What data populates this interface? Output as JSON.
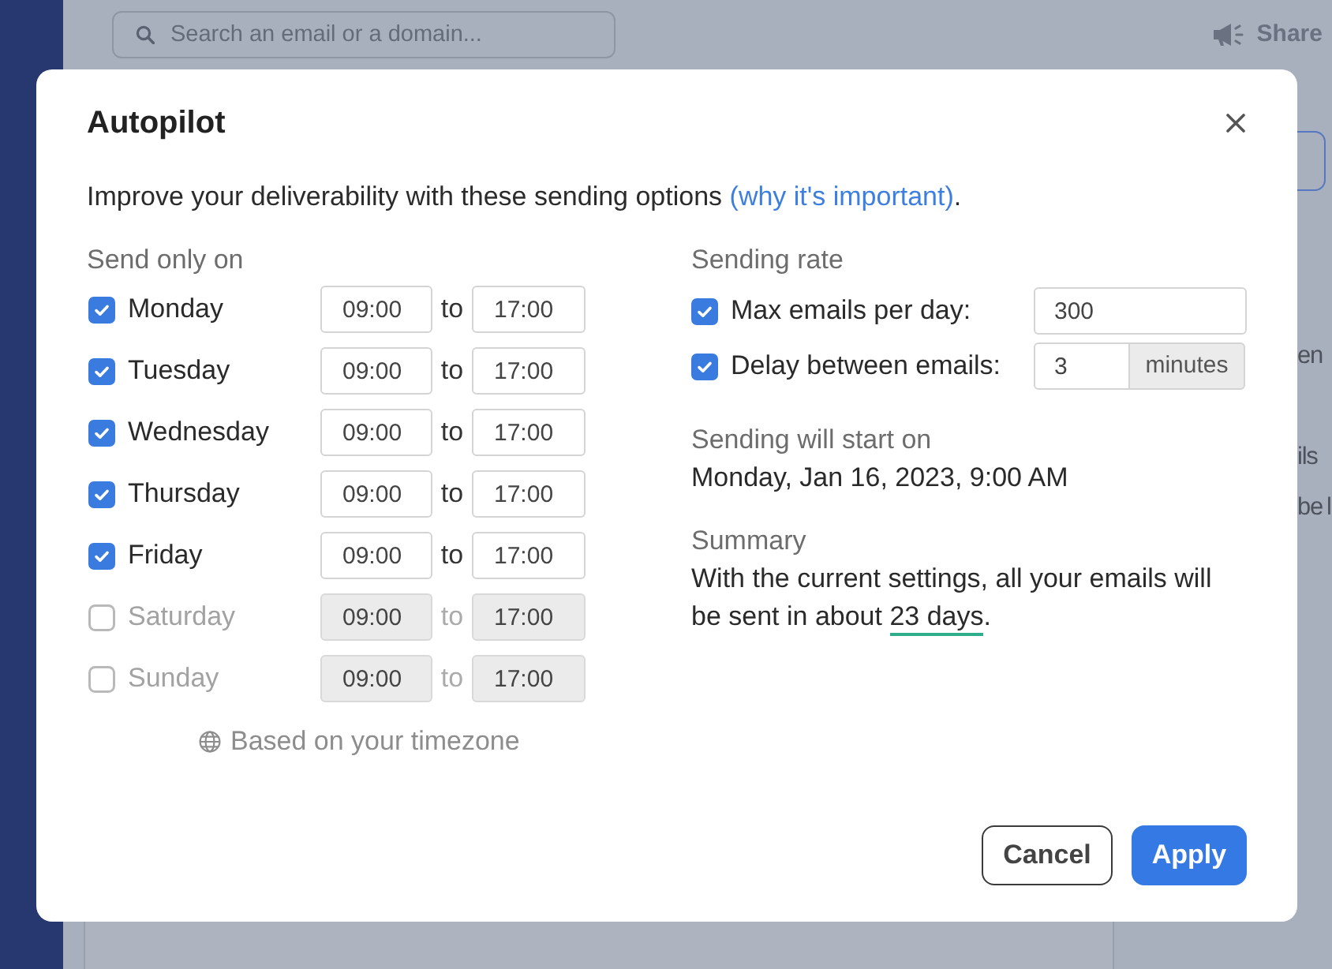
{
  "background": {
    "search": {
      "placeholder": "Search an email or a domain..."
    },
    "share_label": "Share",
    "edge_texts": [
      "en",
      "ils",
      "be l"
    ]
  },
  "dialog": {
    "title": "Autopilot",
    "intro": {
      "text": "Improve your deliverability with these sending options ",
      "link": "(why it's important)",
      "end": "."
    },
    "schedule": {
      "heading": "Send only on",
      "days": [
        {
          "name": "Monday",
          "checked": true,
          "from": "09:00",
          "joiner": "to",
          "to": "17:00"
        },
        {
          "name": "Tuesday",
          "checked": true,
          "from": "09:00",
          "joiner": "to",
          "to": "17:00"
        },
        {
          "name": "Wednesday",
          "checked": true,
          "from": "09:00",
          "joiner": "to",
          "to": "17:00"
        },
        {
          "name": "Thursday",
          "checked": true,
          "from": "09:00",
          "joiner": "to",
          "to": "17:00"
        },
        {
          "name": "Friday",
          "checked": true,
          "from": "09:00",
          "joiner": "to",
          "to": "17:00"
        },
        {
          "name": "Saturday",
          "checked": false,
          "from": "09:00",
          "joiner": "to",
          "to": "17:00"
        },
        {
          "name": "Sunday",
          "checked": false,
          "from": "09:00",
          "joiner": "to",
          "to": "17:00"
        }
      ],
      "note": "Based on your timezone"
    },
    "rate": {
      "heading": "Sending rate",
      "items": [
        {
          "kind": "plain",
          "label": "Max emails per day:",
          "checked": true,
          "value": "300"
        },
        {
          "kind": "unit",
          "label": "Delay between emails:",
          "checked": true,
          "value": "3",
          "unit": "minutes"
        }
      ]
    },
    "start": {
      "heading": "Sending will start on",
      "value": "Monday, Jan 16, 2023, 9:00 AM"
    },
    "summary": {
      "heading": "Summary",
      "text": "With the current settings, all your emails will be sent in about ",
      "highlight": "23 days",
      "end": "."
    },
    "buttons": [
      {
        "kind": "secondary",
        "label": "Cancel"
      },
      {
        "kind": "primary",
        "label": "Apply"
      }
    ]
  }
}
